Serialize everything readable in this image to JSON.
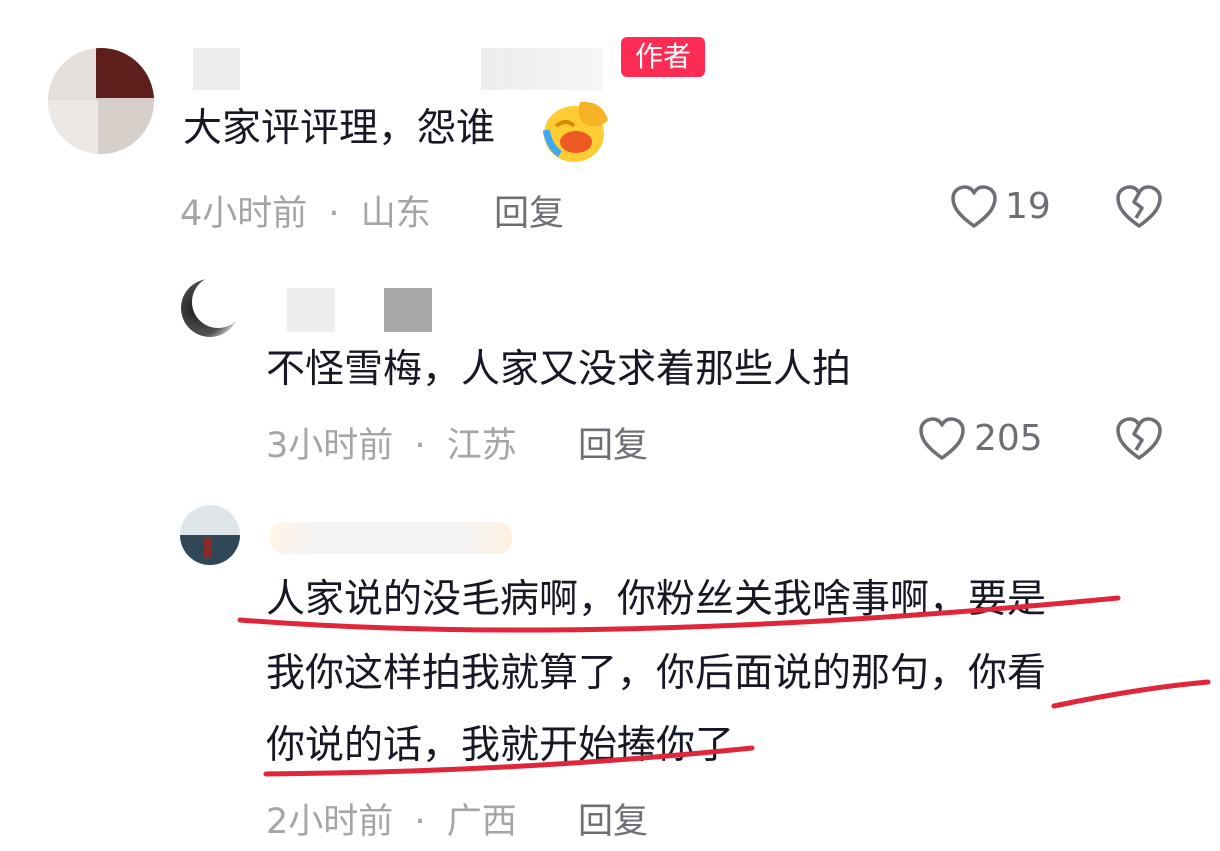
{
  "comments": [
    {
      "author_badge": "作者",
      "text": "大家评评理，怨谁",
      "emoji_icon": "face-palm-crying-emoji",
      "time": "4小时前",
      "location": "山东",
      "reply_label": "回复",
      "likes": "19"
    },
    {
      "text": "不怪雪梅，人家又没求着那些人拍",
      "time": "3小时前",
      "location": "江苏",
      "reply_label": "回复",
      "likes": "205"
    },
    {
      "text_lines": [
        "人家说的没毛病啊，你粉丝关我啥事啊，要是",
        "我你这样拍我就算了，你后面说的那句，你看",
        "你说的话，我就开始捧你了"
      ],
      "time": "2小时前",
      "location": "广西",
      "reply_label": "回复"
    }
  ],
  "separator": "·",
  "colors": {
    "badge": "#fe2c55",
    "annotation": "#e0263a",
    "meta": "#a5a5a9"
  }
}
